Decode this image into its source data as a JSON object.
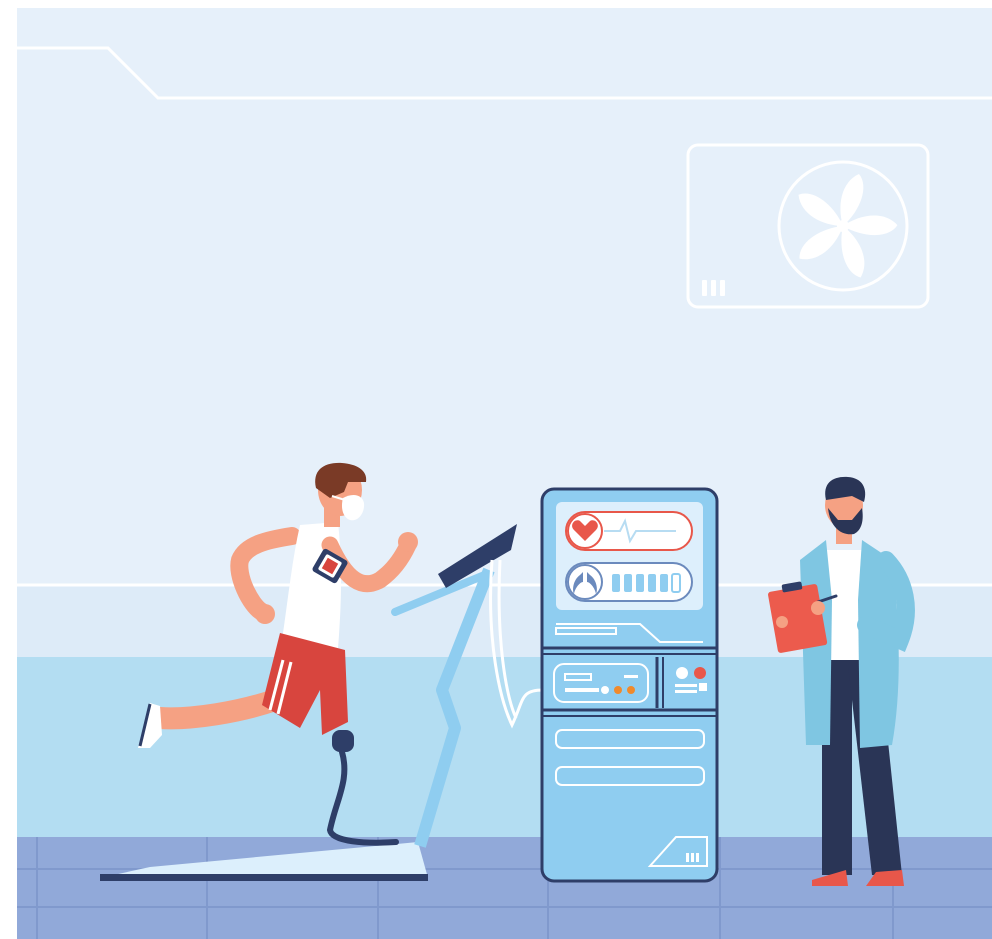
{
  "scene": {
    "description_free": true,
    "palette": {
      "wall_upper": "#E6F0FA",
      "wall_lower": "#DCEAF8",
      "wainscot": "#B3DDF2",
      "floor": "#91A9D9",
      "floor_lines": "#7E97CC",
      "outline_light": "#FFFFFF",
      "navy": "#2E3E68",
      "machine_body": "#8FCDF0",
      "machine_screen": "#DDEFFC",
      "accent_red": "#E8574A",
      "accent_orange": "#F08A2C",
      "skin": "#F5A183",
      "hair": "#7A3A26",
      "shorts": "#D8453E",
      "doctor_coat": "#7FC6E2",
      "doctor_pants": "#2A3556",
      "clipboard": "#EC5B4D",
      "treadmill": "#8FCDF0"
    },
    "icons": [
      "fan-icon",
      "heart-icon",
      "lungs-icon",
      "arm-fitness-tracker-icon",
      "face-mask-icon",
      "prosthetic-leg-icon",
      "clipboard-icon",
      "pen-icon"
    ]
  }
}
